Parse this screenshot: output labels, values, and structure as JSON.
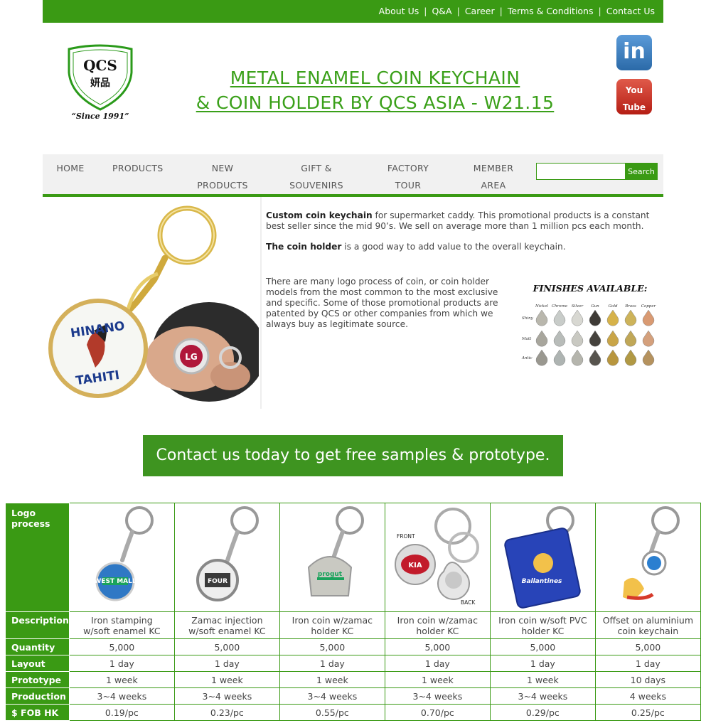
{
  "top_nav": {
    "links": [
      "About Us",
      "Q&A",
      "Career",
      "Terms & Conditions",
      "Contact Us"
    ]
  },
  "logo": {
    "text": "QCS",
    "chinese": "妍品",
    "since": "“Since 1991”"
  },
  "page_title": {
    "line1": "METAL ENAMEL COIN KEYCHAIN",
    "line2": "& COIN HOLDER BY QCS ASIA - W21.15"
  },
  "social": {
    "linkedin": "in",
    "youtube_1": "You",
    "youtube_2": "Tube"
  },
  "main_nav": {
    "items": [
      {
        "line1": "HOME",
        "line2": ""
      },
      {
        "line1": "PRODUCTS",
        "line2": ""
      },
      {
        "line1": "NEW",
        "line2": "PRODUCTS"
      },
      {
        "line1": "GIFT &",
        "line2": "SOUVENIRS"
      },
      {
        "line1": "FACTORY",
        "line2": "TOUR"
      },
      {
        "line1": "MEMBER",
        "line2": "AREA"
      }
    ],
    "search_button": "Search",
    "search_value": ""
  },
  "intro": {
    "p1_bold": "Custom coin keychain",
    "p1_rest": " for supermarket caddy. This promotional products is a constant best seller since the mid 90’s. We sell on average more than 1 million pcs each month.",
    "p2_bold": "The coin holder",
    "p2_rest": " is a good way to add value to the overall keychain.",
    "p3": "There are many logo process of coin, or coin holder models from the most common to the most exclusive and specific. Some of those promotional products are patented by QCS or other companies from which we always buy as legitimate source."
  },
  "hero_image": {
    "coin_line1": "HINANO",
    "coin_line2": "TAHITI",
    "badge": "LG"
  },
  "finishes": {
    "title": "FINISHES AVAILABLE:",
    "columns": [
      "Nickel",
      "Chrome",
      "Silver",
      "Gun",
      "Gold",
      "Brass",
      "Copper"
    ],
    "rows": [
      "Shiny",
      "Matt",
      "Antic"
    ],
    "colors": {
      "Shiny": [
        "#b9b7ad",
        "#c8ccc9",
        "#d8d8d2",
        "#3e3b36",
        "#d6b24a",
        "#cdb35a",
        "#d99a72"
      ],
      "Matt": [
        "#a8a69d",
        "#b8bcb9",
        "#c9c9c2",
        "#45423d",
        "#c9a548",
        "#c0a757",
        "#d4a07c"
      ],
      "Antic": [
        "#9a9890",
        "#aeb4b2",
        "#b5b5ad",
        "#57544e",
        "#b8963e",
        "#b19944",
        "#b5925e"
      ]
    }
  },
  "cta": {
    "label": "Contact us today to get free samples & prototype."
  },
  "spec_table": {
    "headers": {
      "logo_process": "Logo process",
      "description": "Description",
      "quantity": "Quantity",
      "layout": "Layout",
      "prototype": "Prototype",
      "production": "Production",
      "fob": "$ FOB HK"
    },
    "product_images": [
      {
        "label": "WEST MALL"
      },
      {
        "label": "FOUR"
      },
      {
        "label": "progut"
      },
      {
        "front": "FRONT",
        "back": "BACK",
        "label": "KIA"
      },
      {
        "label": "Ballantines"
      },
      {
        "label": ""
      }
    ],
    "products": [
      {
        "description": "Iron stamping w/soft enamel KC",
        "quantity": "5,000",
        "layout": "1 day",
        "prototype": "1 week",
        "production": "3~4 weeks",
        "fob": "0.19/pc"
      },
      {
        "description": "Zamac injection w/soft enamel KC",
        "quantity": "5,000",
        "layout": "1 day",
        "prototype": "1 week",
        "production": "3~4 weeks",
        "fob": "0.23/pc"
      },
      {
        "description": "Iron coin w/zamac holder KC",
        "quantity": "5,000",
        "layout": "1 day",
        "prototype": "1 week",
        "production": "3~4 weeks",
        "fob": "0.55/pc"
      },
      {
        "description": "Iron coin w/zamac holder KC",
        "quantity": "5,000",
        "layout": "1 day",
        "prototype": "1 week",
        "production": "3~4 weeks",
        "fob": "0.70/pc"
      },
      {
        "description": "Iron coin w/soft PVC holder KC",
        "quantity": "5,000",
        "layout": "1 day",
        "prototype": "1 week",
        "production": "3~4 weeks",
        "fob": "0.29/pc"
      },
      {
        "description": "Offset on aluminium coin keychain",
        "quantity": "5,000",
        "layout": "1 day",
        "prototype": "10 days",
        "production": "4 weeks",
        "fob": "0.25/pc"
      }
    ]
  }
}
